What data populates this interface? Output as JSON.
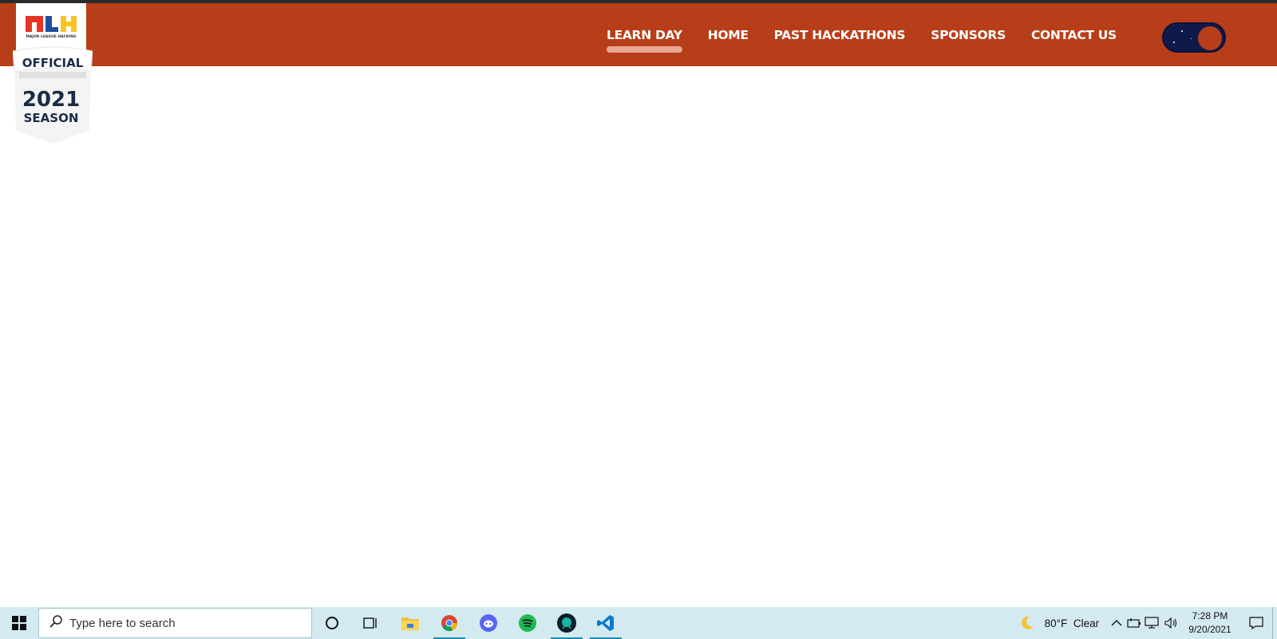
{
  "navbar": {
    "links": [
      {
        "label": "LEARN DAY",
        "active": true
      },
      {
        "label": "HOME",
        "active": false
      },
      {
        "label": "PAST HACKATHONS",
        "active": false
      },
      {
        "label": "SPONSORS",
        "active": false
      },
      {
        "label": "CONTACT US",
        "active": false
      }
    ],
    "theme_toggle_icon": "dark-mode-toggle",
    "colors": {
      "bar": "#b83e1a",
      "toggle": "#0f1a4a",
      "active_underline": "#e8a893"
    }
  },
  "badge": {
    "logo_text": "MLH",
    "logo_subtext": "MAJOR LEAGUE HACKING",
    "official": "OFFICIAL",
    "year": "2021",
    "season": "SEASON"
  },
  "taskbar": {
    "search_placeholder": "Type here to search",
    "apps": [
      "windows-start-icon",
      "cortana-icon",
      "task-view-icon",
      "file-explorer-icon",
      "chrome-icon",
      "discord-icon",
      "spotify-icon",
      "gitkraken-icon",
      "vscode-icon"
    ],
    "weather_temp": "80°F",
    "weather_condition": "Clear",
    "time": "7:28 PM",
    "date": "9/20/2021"
  }
}
